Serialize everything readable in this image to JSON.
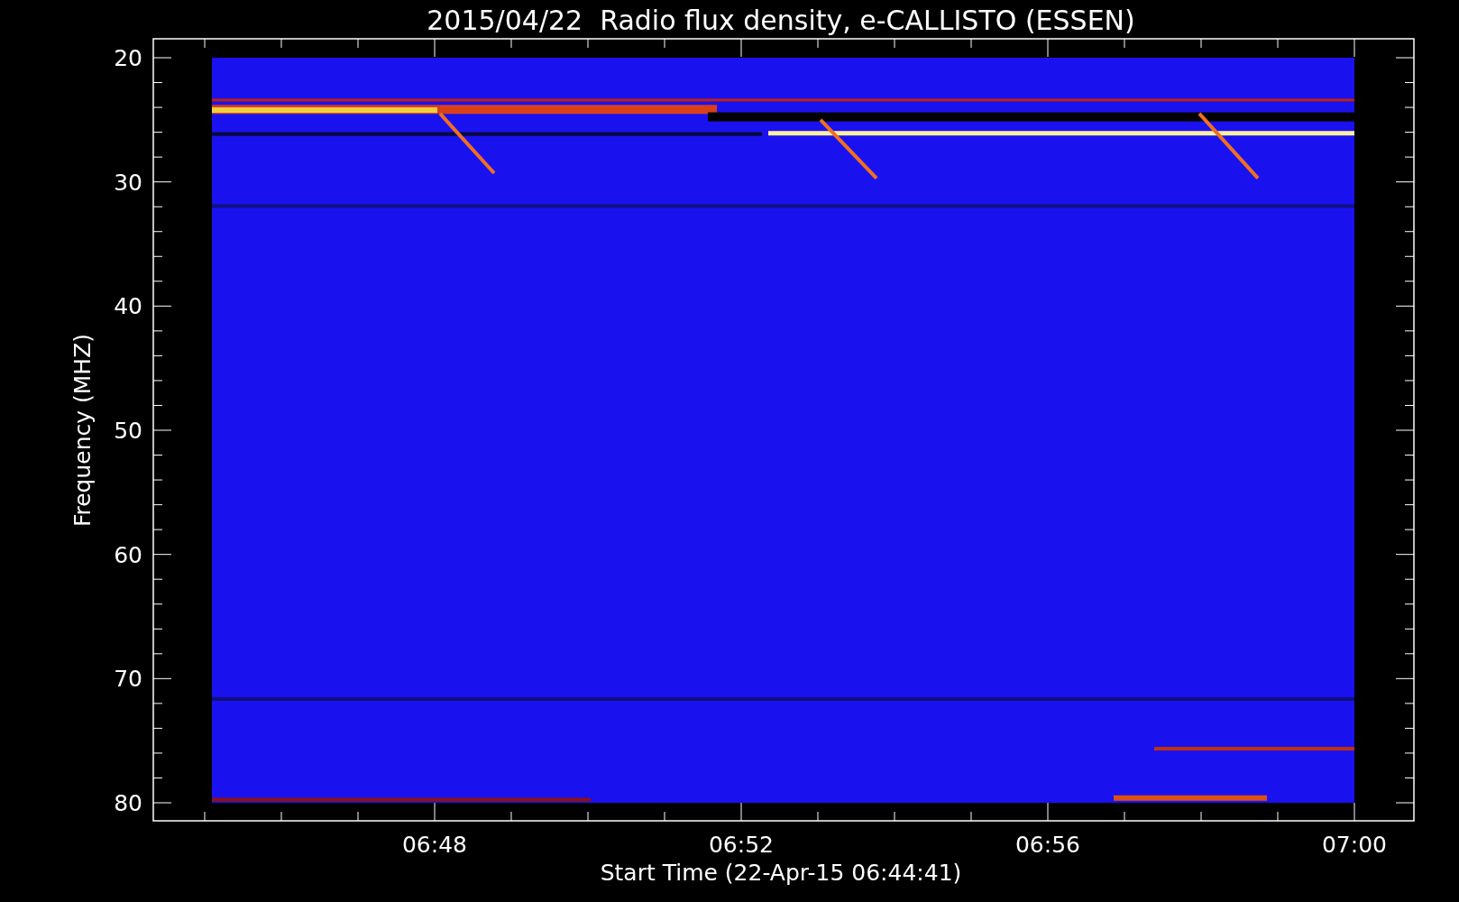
{
  "title": "2015/04/22  Radio flux density, e-CALLISTO (ESSEN)",
  "y_axis": {
    "label": "Frequency (MHZ)",
    "ticks": [
      "20",
      "30",
      "40",
      "50",
      "60",
      "70",
      "80"
    ]
  },
  "x_axis": {
    "label": "Start Time (22-Apr-15 06:44:41)",
    "ticks": [
      "06:48",
      "06:52",
      "06:56",
      "07:00"
    ]
  }
}
